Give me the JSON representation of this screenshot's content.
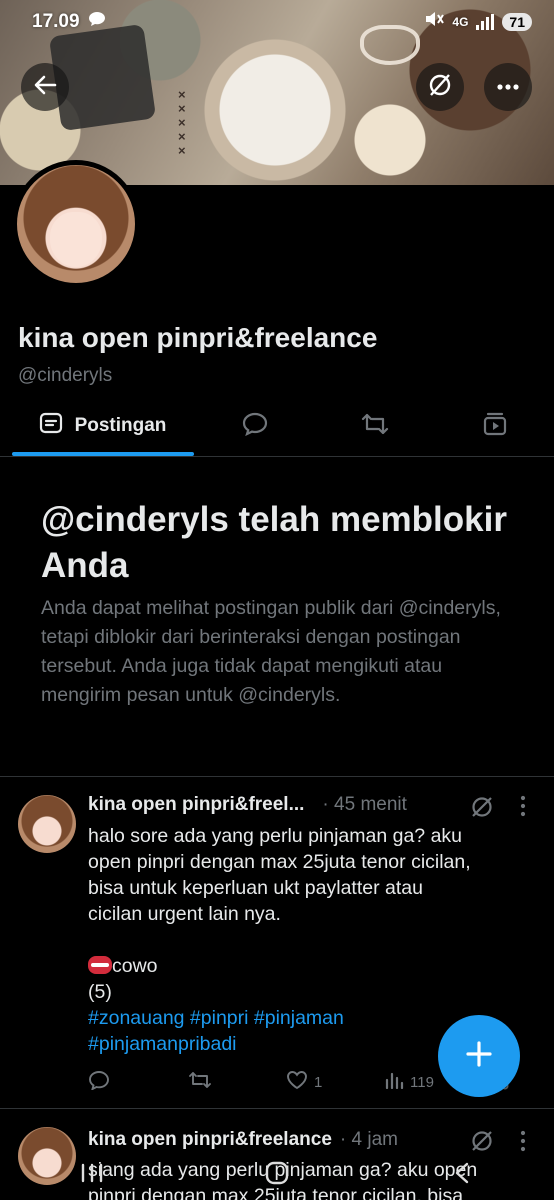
{
  "status_bar": {
    "time": "17.09",
    "network": "4G",
    "battery": "71"
  },
  "profile": {
    "name": "kina open pinpri&freelance",
    "handle": "@cinderyls"
  },
  "tabs": {
    "posts_label": "Postingan"
  },
  "blocked": {
    "title": "@cinderyls telah memblokir Anda",
    "description": "Anda dapat melihat postingan publik dari @cinderyls, tetapi diblokir dari berinteraksi dengan postingan tersebut. Anda juga tidak dapat mengikuti atau mengirim pesan untuk @cinderyls."
  },
  "posts": [
    {
      "author": "kina open pinpri&freel...",
      "time": "· 45 menit",
      "text_lines": [
        "halo sore ada yang perlu pinjaman ga? aku",
        "open pinpri dengan max 25juta tenor cicilan,",
        "bisa untuk keperluan ukt paylatter atau",
        "cicilan urgent lain nya."
      ],
      "emoji": "👄",
      "tag_line": "cowo",
      "count_line": "(5)",
      "hashtags_line1": "#zonauang #pinpri #pinjaman",
      "hashtags_line2": "#pinjamanpribadi",
      "likes": "1",
      "views": "119"
    },
    {
      "author": "kina open pinpri&freelance",
      "time": "· 4 jam",
      "text_lines": [
        "siang ada yang perlu pinjaman ga? aku open",
        "pinpri dengan max 25juta tenor cicilan, bisa"
      ]
    }
  ],
  "icons": {
    "back": "arrow-left-icon",
    "grok": "grok-icon",
    "more": "more-horizontal-icon",
    "fab": "plus-icon",
    "accent": "#1d9bf0"
  }
}
